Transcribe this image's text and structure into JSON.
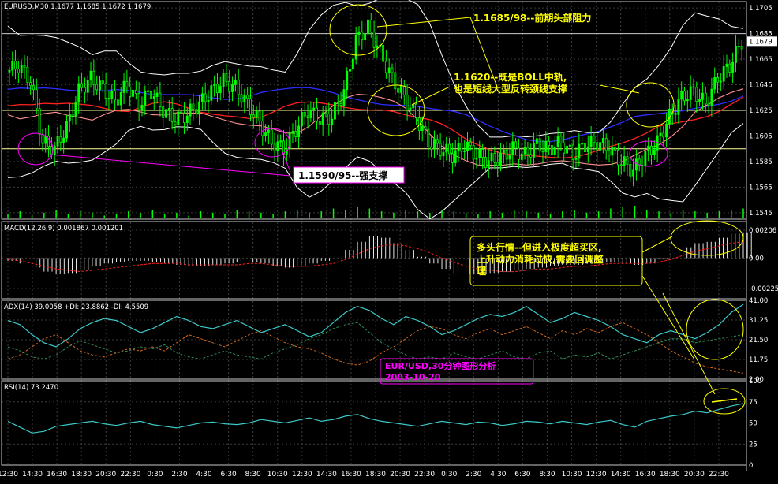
{
  "colors": {
    "background": "#000000",
    "grid": "#3a3a3a",
    "frame": "#c8c8c8",
    "axis_text": "#ffffff",
    "bull": "#00ff00",
    "bear": "#000000",
    "wick": "#00ff00",
    "boll": "#ffffff",
    "ma_blue": "#2d2dff",
    "ma_red": "#ff2020",
    "ma_pink": "#ff9090",
    "support_line": "#ffff99",
    "yellow_note": "#ffff00",
    "magenta_note": "#ff00ff",
    "macd_hist": "#ffffff",
    "macd_signal": "#ff2020",
    "adx_main": "#3cc8c8",
    "plus_di": "#2e8b57",
    "minus_di": "#d2691e",
    "rsi": "#3cc8c8",
    "volume": "#00ff00"
  },
  "chart_data": [
    {
      "type": "candlestick",
      "title": "EURUSD,M30",
      "ohlc_header": [
        "1.1677",
        "1.1685",
        "1.1672",
        "1.1679"
      ],
      "last_price_label": "1.1679",
      "ylim": [
        1.154,
        1.171
      ],
      "yticks": [
        "1.1705",
        "1.1685",
        "1.1665",
        "1.1645",
        "1.1625",
        "1.1605",
        "1.1585",
        "1.1565",
        "1.1545"
      ],
      "ytick_values": [
        1.1705,
        1.1685,
        1.1665,
        1.1645,
        1.1625,
        1.1605,
        1.1585,
        1.1565,
        1.1545
      ],
      "xticks": [
        "12:30",
        "14:30",
        "16:30",
        "18:30",
        "20:30",
        "22:30",
        "0:30",
        "2:30",
        "4:30",
        "6:30",
        "8:30",
        "10:30",
        "12:30",
        "14:30",
        "16:30",
        "18:30",
        "20:30",
        "22:30",
        "0:30",
        "2:30",
        "4:30",
        "6:30",
        "8:30",
        "10:30",
        "12:30",
        "14:30",
        "16:30",
        "18:30",
        "20:30",
        "22:30"
      ],
      "close_path": [
        1.1655,
        1.166,
        1.1648,
        1.16,
        1.1595,
        1.1612,
        1.164,
        1.165,
        1.1642,
        1.1632,
        1.1645,
        1.163,
        1.164,
        1.1625,
        1.1618,
        1.1622,
        1.163,
        1.164,
        1.1648,
        1.1643,
        1.163,
        1.1615,
        1.16,
        1.1595,
        1.161,
        1.1625,
        1.1618,
        1.162,
        1.164,
        1.168,
        1.169,
        1.167,
        1.165,
        1.1635,
        1.162,
        1.16,
        1.1595,
        1.159,
        1.1598,
        1.159,
        1.1585,
        1.1588,
        1.1595,
        1.159,
        1.1598,
        1.1595,
        1.16,
        1.159,
        1.1598,
        1.16,
        1.1595,
        1.1585,
        1.1578,
        1.159,
        1.16,
        1.162,
        1.1635,
        1.164,
        1.163,
        1.165,
        1.166,
        1.1679
      ],
      "horizontal_levels": [
        1.1685,
        1.1625,
        1.1595
      ],
      "annotations": [
        {
          "text": "1.1685/98--前期头部阻力",
          "color": "yellow"
        },
        {
          "text": "1.1620--既是BOLL中轨,",
          "color": "yellow"
        },
        {
          "text": "也是短线大型反转颈线支撑",
          "color": "yellow"
        },
        {
          "text": "1.1590/95--强支撑",
          "color": "magenta",
          "boxed": true
        }
      ]
    },
    {
      "type": "bar",
      "title": "MACD(12,26,9)",
      "values_header": [
        "0.001867",
        "0.001201"
      ],
      "yticks": [
        "0.00206",
        "0.00",
        "-0.00225"
      ],
      "ytick_values": [
        0.00206,
        0.0,
        -0.00225
      ],
      "ylim": [
        -0.003,
        0.0027
      ],
      "histogram": [
        -0.0002,
        -0.0004,
        -0.0007,
        -0.001,
        -0.0012,
        -0.0011,
        -0.0009,
        -0.0006,
        -0.0004,
        -0.0003,
        -0.0002,
        -0.0002,
        -0.0003,
        -0.0004,
        -0.0005,
        -0.0006,
        -0.0006,
        -0.0005,
        -0.0004,
        -0.0003,
        -0.0003,
        -0.0004,
        -0.0006,
        -0.0007,
        -0.0006,
        -0.0004,
        -0.0002,
        0.0,
        0.0006,
        0.0012,
        0.0016,
        0.0015,
        0.0011,
        0.0006,
        0.0001,
        -0.0004,
        -0.0008,
        -0.0011,
        -0.0012,
        -0.0012,
        -0.0011,
        -0.001,
        -0.0009,
        -0.0008,
        -0.0007,
        -0.0006,
        -0.0005,
        -0.0005,
        -0.0004,
        -0.0003,
        -0.0003,
        -0.0004,
        -0.0005,
        -0.0004,
        -0.0001,
        0.0004,
        0.0008,
        0.0011,
        0.0012,
        0.0015,
        0.0018,
        0.0019
      ],
      "signal": [
        -0.0001,
        -0.0002,
        -0.0004,
        -0.0006,
        -0.0008,
        -0.0009,
        -0.001,
        -0.0009,
        -0.0008,
        -0.0007,
        -0.0006,
        -0.0005,
        -0.0004,
        -0.0004,
        -0.0004,
        -0.0005,
        -0.0005,
        -0.0005,
        -0.0005,
        -0.0005,
        -0.0004,
        -0.0004,
        -0.0005,
        -0.0006,
        -0.0006,
        -0.0006,
        -0.0005,
        -0.0004,
        -0.0001,
        0.0003,
        0.0007,
        0.0009,
        0.001,
        0.0009,
        0.0007,
        0.0004,
        0.0,
        -0.0003,
        -0.0006,
        -0.0008,
        -0.0009,
        -0.001,
        -0.001,
        -0.0009,
        -0.0008,
        -0.0008,
        -0.0007,
        -0.0006,
        -0.0006,
        -0.0005,
        -0.0004,
        -0.0004,
        -0.0004,
        -0.0004,
        -0.0003,
        -0.0001,
        0.0002,
        0.0005,
        0.0007,
        0.0009,
        0.0011,
        0.0012
      ],
      "annotation_lines": [
        "多头行情--但进入极度超买区,",
        "上升动力消耗过快,需要回调整",
        "理"
      ]
    },
    {
      "type": "line",
      "title": "ADX(14)",
      "values_header": [
        "39.0058",
        "+DI: 23.8862",
        "-DI: 4.5509"
      ],
      "yticks": [
        "41.00",
        "31.25",
        "21.50",
        "11.75",
        "2.00"
      ],
      "ytick_values": [
        41.0,
        31.25,
        21.5,
        11.75,
        2.0
      ],
      "ylim": [
        2.0,
        41.0
      ],
      "series": [
        {
          "values": [
            31,
            29,
            24,
            20,
            18,
            22,
            27,
            30,
            32,
            31,
            28,
            25,
            27,
            30,
            33,
            31,
            28,
            27,
            29,
            31,
            28,
            25,
            27,
            29,
            26,
            23,
            25,
            30,
            35,
            38,
            36,
            32,
            29,
            33,
            31,
            28,
            24,
            26,
            29,
            32,
            34,
            33,
            35,
            38,
            34,
            30,
            32,
            35,
            33,
            31,
            28,
            24,
            22,
            20,
            24,
            26,
            24,
            22,
            25,
            29,
            35,
            39
          ]
        },
        {
          "values": [
            18,
            16,
            13,
            12,
            14,
            18,
            21,
            19,
            17,
            15,
            16,
            18,
            17,
            19,
            15,
            13,
            12,
            14,
            16,
            14,
            13,
            12,
            15,
            17,
            19,
            22,
            24,
            27,
            29,
            30,
            25,
            20,
            17,
            14,
            12,
            13,
            12,
            15,
            13,
            12,
            14,
            16,
            13,
            12,
            15,
            16,
            12,
            14,
            13,
            15,
            12,
            14,
            16,
            18,
            20,
            22,
            22,
            20,
            21,
            22,
            23,
            24
          ]
        },
        {
          "values": [
            12,
            14,
            18,
            22,
            24,
            20,
            16,
            14,
            13,
            15,
            17,
            16,
            18,
            16,
            20,
            24,
            22,
            20,
            18,
            21,
            24,
            26,
            23,
            20,
            18,
            17,
            15,
            12,
            10,
            9,
            11,
            15,
            18,
            22,
            26,
            28,
            27,
            24,
            22,
            25,
            27,
            24,
            26,
            28,
            25,
            22,
            26,
            24,
            27,
            25,
            28,
            30,
            27,
            24,
            20,
            16,
            13,
            10,
            8,
            7,
            6,
            5
          ]
        }
      ],
      "label_lines": [
        "EUR/USD,30分钟图形分析",
        "2003-10-20"
      ]
    },
    {
      "type": "line",
      "title": "RSI(14)",
      "values_header": [
        "73.2470"
      ],
      "yticks": [
        "100",
        "75",
        "50",
        "25",
        "0"
      ],
      "ytick_values": [
        100,
        75,
        50,
        25,
        0
      ],
      "ylim": [
        0,
        100
      ],
      "series": [
        {
          "values": [
            52,
            45,
            38,
            40,
            46,
            48,
            50,
            52,
            49,
            47,
            50,
            52,
            48,
            46,
            44,
            47,
            50,
            51,
            49,
            48,
            50,
            54,
            52,
            50,
            53,
            56,
            52,
            54,
            58,
            60,
            55,
            52,
            50,
            48,
            46,
            49,
            52,
            50,
            48,
            51,
            50,
            47,
            49,
            52,
            51,
            49,
            52,
            50,
            48,
            51,
            53,
            48,
            45,
            52,
            55,
            58,
            60,
            64,
            62,
            66,
            70,
            73
          ]
        }
      ]
    },
    {
      "type": "bar",
      "title": "volume",
      "values": [
        3,
        5,
        2,
        4,
        6,
        3,
        5,
        4,
        2,
        3,
        5,
        4,
        6,
        3,
        4,
        2,
        5,
        4,
        3,
        6,
        5,
        4,
        3,
        5,
        6,
        4,
        5,
        7,
        6,
        8,
        7,
        5,
        4,
        6,
        5,
        4,
        6,
        5,
        4,
        3,
        5,
        4,
        6,
        5,
        4,
        3,
        5,
        6,
        4,
        5,
        7,
        8,
        9,
        6,
        5,
        4,
        6,
        5,
        4,
        5,
        6,
        7
      ]
    }
  ]
}
